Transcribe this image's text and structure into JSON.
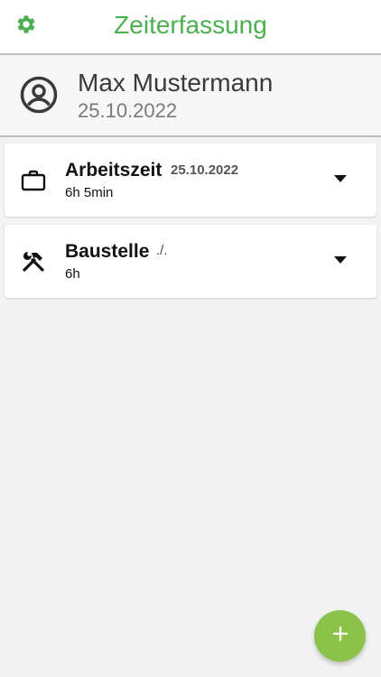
{
  "appbar": {
    "title": "Zeiterfassung",
    "settings_icon": "gear-icon"
  },
  "user": {
    "name": "Max Mustermann",
    "date": "25.10.2022",
    "avatar_icon": "account-circle-icon"
  },
  "cards": [
    {
      "title": "Arbeitszeit",
      "date": "25.10.2022",
      "subtitle": "6h 5min",
      "icon": "briefcase-icon",
      "dropdown_icon": "caret-down-icon"
    },
    {
      "title": "Baustelle",
      "mark": "./.",
      "subtitle": "6h",
      "icon": "tools-icon",
      "dropdown_icon": "caret-down-icon"
    }
  ],
  "fab": {
    "icon": "plus-icon"
  },
  "colors": {
    "accent": "#4caf50",
    "fab": "#8bc34a",
    "background": "#f3f3f3"
  }
}
